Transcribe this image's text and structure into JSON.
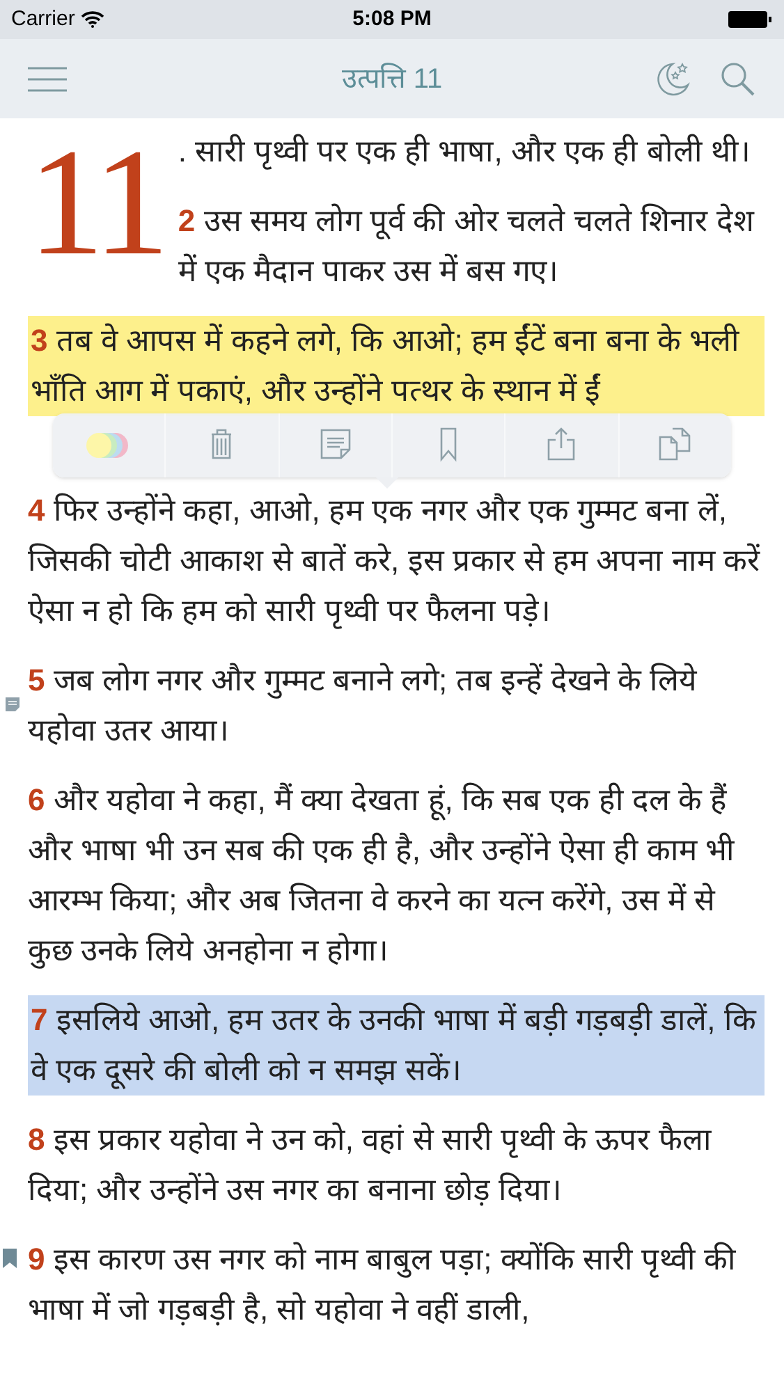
{
  "status_bar": {
    "carrier": "Carrier",
    "time": "5:08 PM"
  },
  "nav": {
    "title": "उत्पत्ति 11"
  },
  "chapter": {
    "number": "11",
    "verses": [
      {
        "text": ". सारी पृथ्वी पर एक ही भाषा, और एक ही बोली थी।",
        "note": false,
        "bookmarked": false
      },
      {
        "number": "2",
        "text": "उस समय लोग पूर्व की ओर चलते चलते शिनार देश में एक मैदान पाकर उस में बस गए।",
        "note": false,
        "bookmarked": false
      },
      {
        "number": "3",
        "text": "तब वे आपस में कहने लगे, कि आओ; हम ईंटें बना बना के भली भाँति आग में पकाएं, और उन्होंने पत्थर के स्थान में ईं",
        "note": false,
        "bookmarked": false,
        "color": "#fdf08c"
      },
      {
        "number": "4",
        "text": "फिर उन्होंने कहा, आओ, हम एक नगर और एक गुम्मट बना लें, जिसकी चोटी आकाश से बातें करे, इस प्रकार से हम अपना नाम करें ऐसा न हो कि हम को सारी पृथ्वी पर फैलना पड़े।",
        "note": false,
        "bookmarked": false
      },
      {
        "number": "5",
        "text": "जब लोग नगर और गुम्मट बनाने लगे; तब इन्हें देखने के लिये यहोवा उतर आया।",
        "note": true,
        "bookmarked": false
      },
      {
        "number": "6",
        "text": "और यहोवा ने कहा, मैं क्या देखता हूं, कि सब एक ही दल के हैं और भाषा भी उन सब की एक ही है, और उन्होंने ऐसा ही काम भी आरम्भ किया; और अब जितना वे करने का यत्न करेंगे, उस में से कुछ उनके लिये अनहोना न होगा।",
        "note": false,
        "bookmarked": false
      },
      {
        "number": "7",
        "text": "इसलिये आओ, हम उतर के उनकी भाषा में बड़ी गड़बड़ी डालें, कि वे एक दूसरे की बोली को न समझ सकें।",
        "note": false,
        "bookmarked": false,
        "color": "#c6d8f2"
      },
      {
        "number": "8",
        "text": "इस प्रकार यहोवा ने उन को, वहां से सारी पृथ्वी के ऊपर फैला दिया; और उन्होंने उस नगर का बनाना छोड़ दिया।",
        "note": false,
        "bookmarked": false
      },
      {
        "number": "9",
        "text": "इस कारण उस नगर को नाम बाबुल पड़ा; क्योंकि सारी पृथ्वी की भाषा में जो गड़बड़ी है, सो यहोवा ने वहीं डाली,",
        "note": false,
        "bookmarked": true
      }
    ]
  },
  "popup": {
    "buttons": [
      {
        "kind": "colors"
      },
      {
        "kind": "delete"
      },
      {
        "kind": "note"
      },
      {
        "kind": "bookmark"
      },
      {
        "kind": "share"
      },
      {
        "kind": "copy"
      }
    ]
  }
}
